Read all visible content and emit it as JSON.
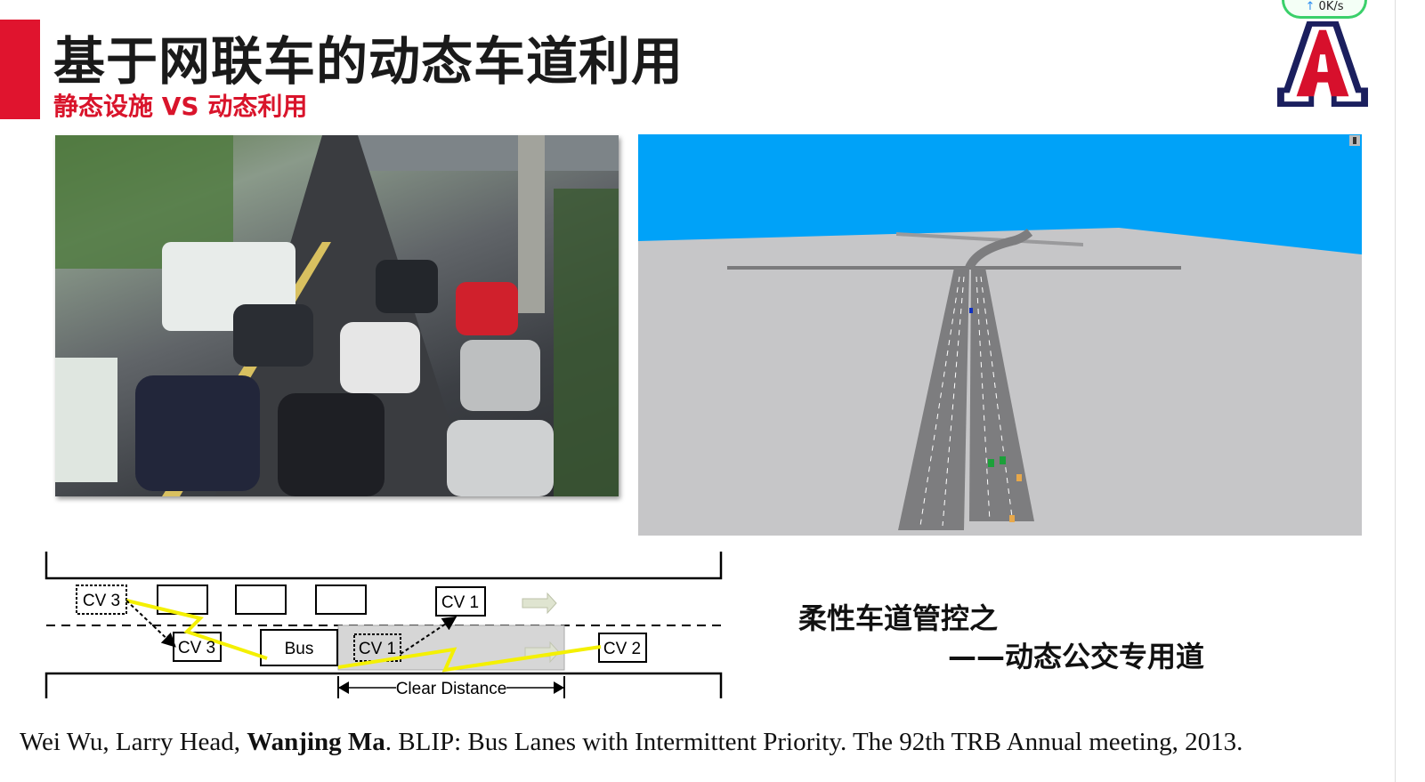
{
  "slide": {
    "title": "基于网联车的动态车道利用",
    "subtitle": "静态设施 VS 动态利用",
    "accent_color": "#e0142e",
    "note_line1": "柔性车道管控之",
    "note_line2": "——动态公交专用道",
    "citation": {
      "authors_before": "Wei Wu, Larry Head, ",
      "bold_author": "Wanjing Ma",
      "rest": ". BLIP: Bus Lanes with Intermittent Priority. The 92th TRB Annual meeting, 2013."
    }
  },
  "logo": {
    "letter": "A",
    "colors": {
      "red": "#d7102c",
      "navy": "#1b1f5e"
    }
  },
  "net_badge": {
    "text": "0K/s",
    "icon": "arrow-up-icon"
  },
  "photo": {
    "description_icon": "traffic-photo"
  },
  "simulation": {
    "sky_color": "#00a2f8",
    "ground_color": "#c6c6c8",
    "icon": "traffic-light-icon"
  },
  "diagram": {
    "labels": {
      "cv3_ghost": "CV 3",
      "cv3": "CV 3",
      "bus": "Bus",
      "cv1_ghost": "CV 1",
      "cv1": "CV 1",
      "cv2": "CV 2",
      "clear_distance": "Clear Distance"
    }
  }
}
